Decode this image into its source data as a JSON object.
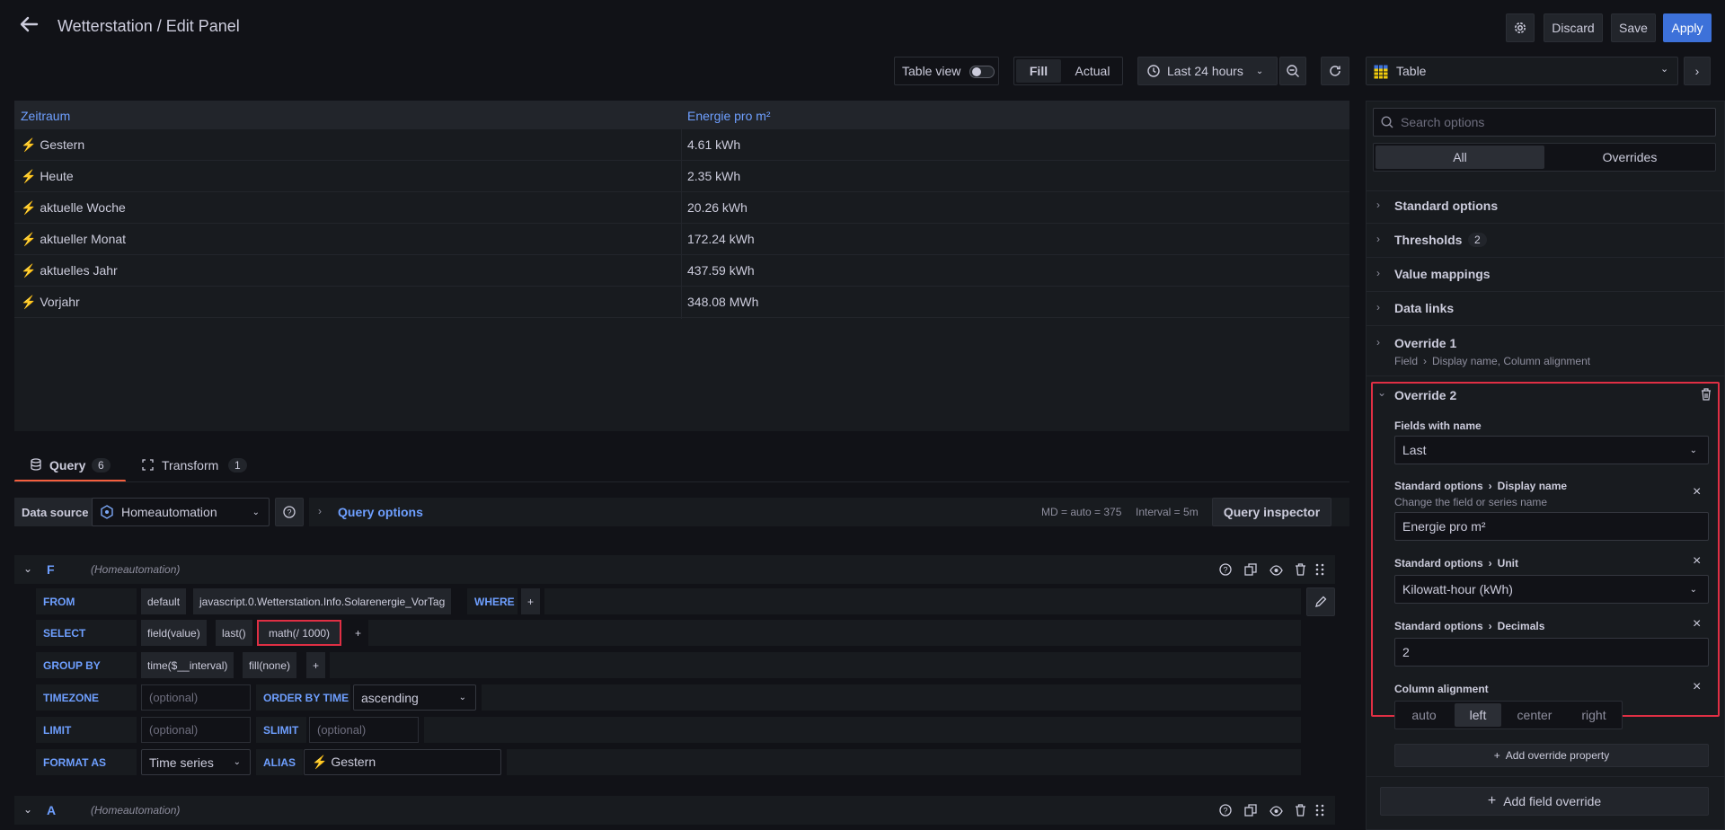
{
  "header": {
    "title": "Wetterstation / Edit Panel",
    "discard_label": "Discard",
    "save_label": "Save",
    "apply_label": "Apply"
  },
  "toolbar": {
    "table_view_label": "Table view",
    "table_view_on": false,
    "fill_label": "Fill",
    "actual_label": "Actual",
    "time_range_label": "Last 24 hours"
  },
  "table": {
    "columns": [
      "Zeitraum",
      "Energie pro m²"
    ],
    "rows": [
      [
        "⚡ Gestern",
        "4.61 kWh"
      ],
      [
        "⚡ Heute",
        "2.35 kWh"
      ],
      [
        "⚡ aktuelle Woche",
        "20.26 kWh"
      ],
      [
        "⚡ aktueller Monat",
        "172.24 kWh"
      ],
      [
        "⚡ aktuelles Jahr",
        "437.59 kWh"
      ],
      [
        "⚡ Vorjahr",
        "348.08 MWh"
      ]
    ]
  },
  "tabs": {
    "query_label": "Query",
    "query_count": "6",
    "transform_label": "Transform",
    "transform_count": "1"
  },
  "datasource": {
    "label": "Data source",
    "value": "Homeautomation",
    "query_options_label": "Query options",
    "md_info": "MD = auto = 375",
    "interval_info": "Interval = 5m",
    "inspector_label": "Query inspector"
  },
  "query_f": {
    "letter": "F",
    "datasource": "(Homeautomation)",
    "from_kw": "FROM",
    "from_policy": "default",
    "from_measurement": "javascript.0.Wetterstation.Info.Solarenergie_VorTag",
    "where_kw": "WHERE",
    "select_kw": "SELECT",
    "select_field": "field(value)",
    "select_last": "last()",
    "select_math": "math(/ 1000)",
    "groupby_kw": "GROUP BY",
    "groupby_time": "time($__interval)",
    "groupby_fill": "fill(none)",
    "timezone_kw": "TIMEZONE",
    "timezone_placeholder": "(optional)",
    "orderby_kw": "ORDER BY TIME",
    "orderby_value": "ascending",
    "limit_kw": "LIMIT",
    "limit_placeholder": "(optional)",
    "slimit_kw": "SLIMIT",
    "slimit_placeholder": "(optional)",
    "format_kw": "FORMAT AS",
    "format_value": "Time series",
    "alias_kw": "ALIAS",
    "alias_value": "⚡ Gestern",
    "plus": "+"
  },
  "query_a": {
    "letter": "A",
    "datasource": "(Homeautomation)"
  },
  "options_panel": {
    "visualization": "Table",
    "search_placeholder": "Search options",
    "tab_all": "All",
    "tab_overrides": "Overrides",
    "sections": {
      "standard": "Standard options",
      "thresholds": "Thresholds",
      "thresholds_count": "2",
      "value_mappings": "Value mappings",
      "data_links": "Data links",
      "override1": "Override 1",
      "override1_field": "Field",
      "override1_props": "Display name, Column alignment"
    },
    "override2": {
      "title": "Override 2",
      "matcher_label": "Fields with name",
      "matcher_value": "Last",
      "p1_group": "Standard options",
      "p1_name": "Display name",
      "p1_desc": "Change the field or series name",
      "p1_value": "Energie pro m²",
      "p2_group": "Standard options",
      "p2_name": "Unit",
      "p2_value": "Kilowatt-hour (kWh)",
      "p3_group": "Standard options",
      "p3_name": "Decimals",
      "p3_value": "2",
      "p4_name": "Column alignment",
      "align_options": [
        "auto",
        "left",
        "center",
        "right"
      ],
      "align_selected": "left"
    },
    "add_property_label": "Add override property",
    "add_field_override_label": "Add field override"
  },
  "colors": {
    "accent_blue": "#3d71d9",
    "link_blue": "#6e9fff",
    "highlight_red": "#e02f44",
    "tab_orange": "#f55f3e",
    "bolt_yellow": "#f2cc0c"
  }
}
